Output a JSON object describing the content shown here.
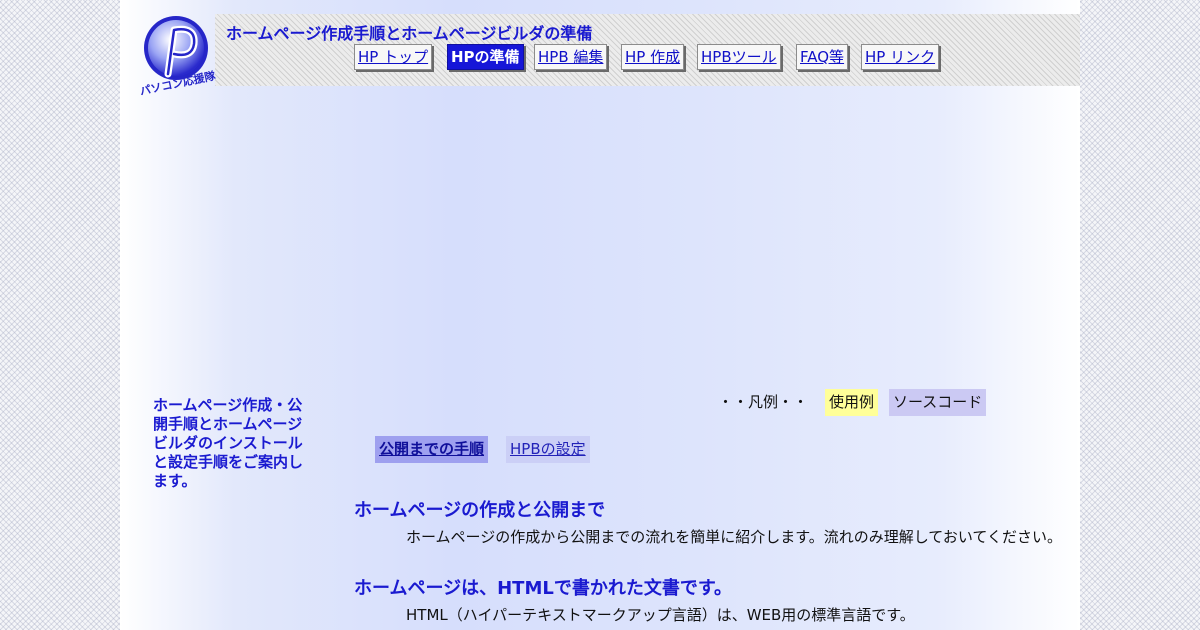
{
  "header": {
    "site_title": "ホームページ作成手順とホームページビルダの準備",
    "logo_caption": "パソコン応援隊"
  },
  "nav": {
    "items": [
      {
        "label": "HP トップ",
        "active": false
      },
      {
        "label": "HPの準備",
        "active": true
      },
      {
        "label": "HPB 編集",
        "active": false
      },
      {
        "label": "HP 作成",
        "active": false
      },
      {
        "label": "HPBツール",
        "active": false
      },
      {
        "label": "FAQ等",
        "active": false
      },
      {
        "label": "HP リンク",
        "active": false
      }
    ]
  },
  "sidebar": {
    "intro": "ホームページ作成・公開手順とホームページビルダのインストールと設定手順をご案内します。"
  },
  "legend": {
    "label": "・・凡例・・",
    "example": "使用例",
    "source": "ソースコード",
    "example_color": "#ffff99",
    "source_color": "#cbc9f3"
  },
  "subtabs": {
    "items": [
      {
        "label": "公開までの手順",
        "active": true
      },
      {
        "label": "HPBの設定",
        "active": false
      }
    ]
  },
  "content": {
    "section1_heading": "ホームページの作成と公開まで",
    "section1_text": "ホームページの作成から公開までの流れを簡単に紹介します。流れのみ理解しておいてください。",
    "section2_heading": "ホームページは、HTMLで書かれた文書です。",
    "section2_text": "HTML（ハイパーテキストマークアップ言語）は、WEB用の標準言語です。"
  },
  "colors": {
    "accent": "#1a1ad0",
    "active_nav_bg": "#1616d8"
  }
}
